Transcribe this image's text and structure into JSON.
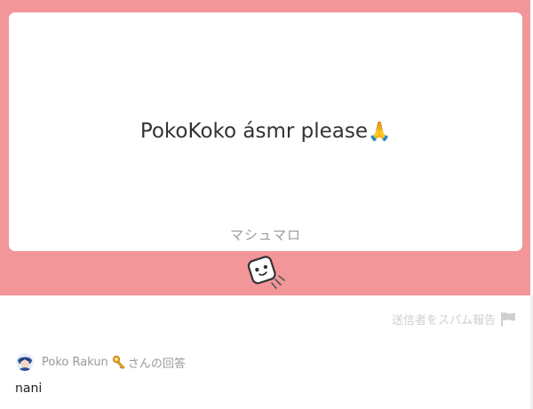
{
  "card": {
    "question_text": "PokoKoko ásmr please",
    "question_emoji": "🙏",
    "brand": "マシュマロ"
  },
  "mascot": {
    "icon": "marshmallow-mascot-icon"
  },
  "report": {
    "label": "送信者をスパム報告",
    "icon": "flag-icon"
  },
  "answer": {
    "author": "Poko Rakun",
    "author_badge_icon": "key-icon",
    "suffix": "さんの回答",
    "text": "nani"
  },
  "colors": {
    "banner": "#f39699",
    "card": "#ffffff",
    "muted_text": "#999999"
  }
}
